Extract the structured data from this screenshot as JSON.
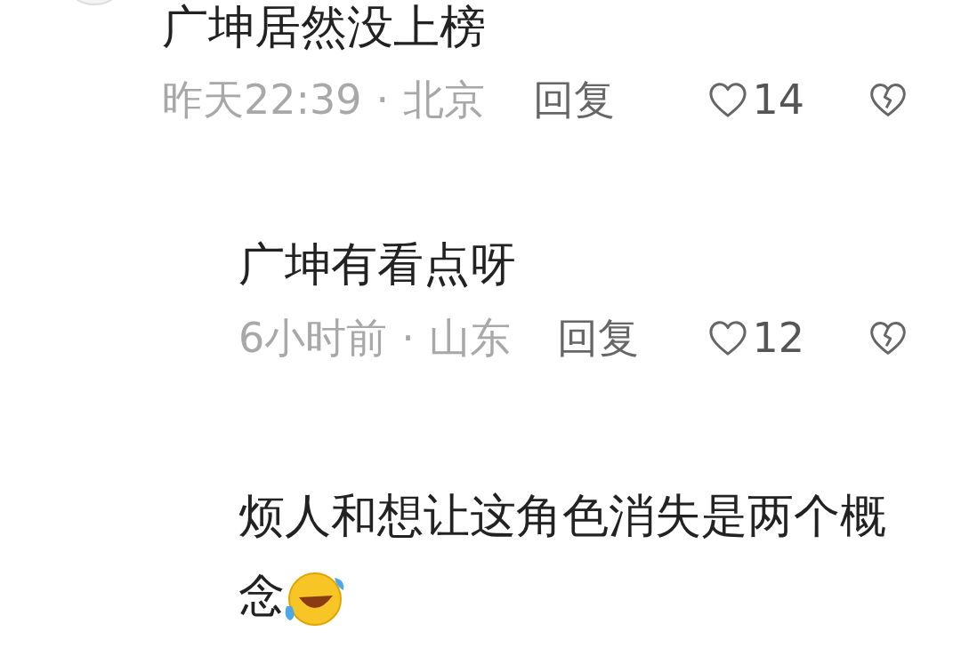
{
  "comments": [
    {
      "text": "广坤居然没上榜",
      "time": "昨天22:39",
      "separator": "·",
      "location": "北京",
      "reply": "回复",
      "likes": "14",
      "liked": false,
      "children": [
        {
          "text": "广坤有看点呀",
          "time": "6小时前",
          "separator": "·",
          "location": "山东",
          "reply": "回复",
          "likes": "12",
          "liked": false
        },
        {
          "text": "烦人和想让这角色消失是两个概念",
          "has_emoji": true
        }
      ]
    }
  ]
}
